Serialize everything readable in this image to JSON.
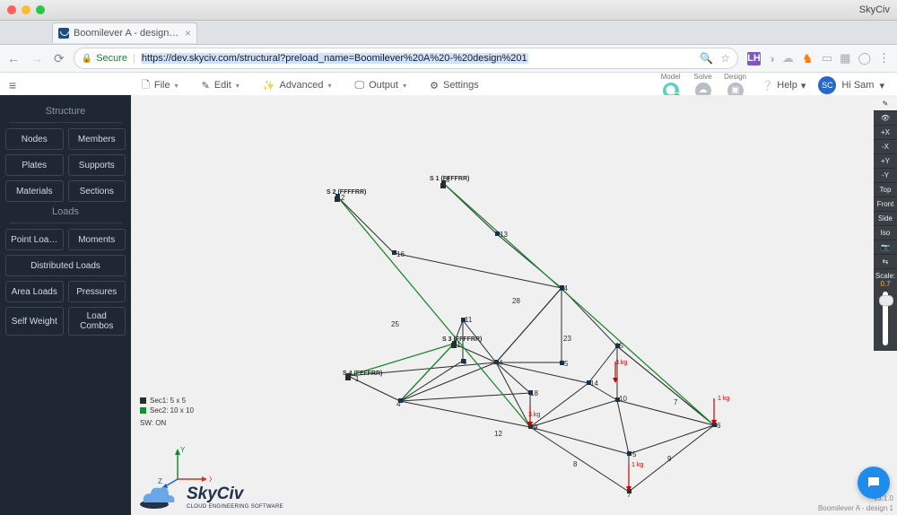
{
  "browser": {
    "app_title": "SkyCiv",
    "tab_title": "Boomilever A - design 1 | Sky…",
    "secure_label": "Secure",
    "url": "https://dev.skyciv.com/structural?preload_name=Boomilever%20A%20-%20design%201"
  },
  "toolbar": {
    "file": "File",
    "edit": "Edit",
    "advanced": "Advanced",
    "output": "Output",
    "settings": "Settings",
    "model": "Model",
    "solve": "Solve",
    "design": "Design",
    "help": "Help",
    "user_short": "SC",
    "user_greeting": "Hi Sam"
  },
  "sidebar": {
    "structure_title": "Structure",
    "loads_title": "Loads",
    "structure": [
      "Nodes",
      "Members",
      "Plates",
      "Supports",
      "Materials",
      "Sections"
    ],
    "loads": [
      "Point Loa…",
      "Moments"
    ],
    "dist": "Distributed Loads",
    "loads2": [
      "Area Loads",
      "Pressures"
    ],
    "loads3a": "Self Weight",
    "loads3b": "Load Combos"
  },
  "legend": {
    "sec1": "Sec1: 5 x 5",
    "sec2": "Sec2: 10 x 10",
    "sw": "SW: ON"
  },
  "viewtools": {
    "items": [
      "✎",
      "👁",
      "+X",
      "-X",
      "+Y",
      "-Y",
      "Top",
      "Front",
      "Side",
      "Iso",
      "📷",
      "⇆"
    ],
    "scale_label": "Scale:",
    "scale_value": "0.7"
  },
  "footer": {
    "doc": "Boomilever A - design 1",
    "ver": "v3.1.0"
  },
  "gizmo": {
    "x": "X",
    "y": "Y",
    "z": "Z"
  },
  "model": {
    "supports": [
      {
        "id": "S 1",
        "code": "(FFFFRR)"
      },
      {
        "id": "S 2",
        "code": "(FFFFRR)"
      },
      {
        "id": "S 3",
        "code": "(FFFFRR)"
      },
      {
        "id": "S 4",
        "code": "(FFFFRR)"
      }
    ],
    "load_label": "1 kg"
  }
}
